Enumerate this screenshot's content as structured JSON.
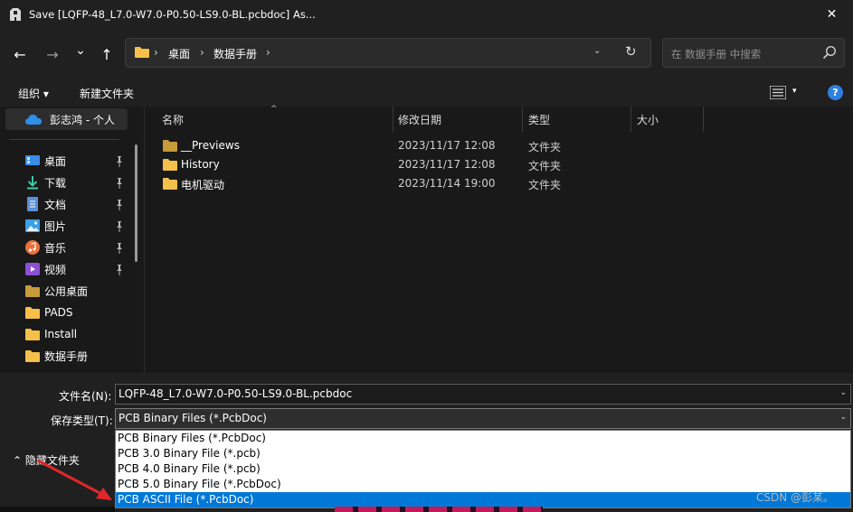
{
  "window": {
    "title": "Save [LQFP-48_L7.0-W7.0-P0.50-LS9.0-BL.pcbdoc] As...",
    "close_glyph": "✕"
  },
  "nav": {
    "back_glyph": "←",
    "forward_glyph": "→",
    "recent_glyph": "⌄",
    "up_glyph": "↑",
    "breadcrumbs": [
      "桌面",
      "数据手册"
    ],
    "crumb_sep": "›",
    "refresh_glyph": "↻",
    "dropdown_glyph": "⌄",
    "search_placeholder": "在 数据手册 中搜索"
  },
  "toolbar": {
    "organize_label": "组织 ▾",
    "new_folder_label": "新建文件夹",
    "view_caret": "▾",
    "help_glyph": "?"
  },
  "sidebar": {
    "cloud_label": "彭志鸿 - 个人",
    "items": [
      {
        "label": "桌面",
        "icon": "desktop-icon",
        "pinned": true
      },
      {
        "label": "下载",
        "icon": "download-icon",
        "pinned": true
      },
      {
        "label": "文档",
        "icon": "document-icon",
        "pinned": true
      },
      {
        "label": "图片",
        "icon": "picture-icon",
        "pinned": true
      },
      {
        "label": "音乐",
        "icon": "music-icon",
        "pinned": true
      },
      {
        "label": "视频",
        "icon": "video-icon",
        "pinned": true
      },
      {
        "label": "公用桌面",
        "icon": "folder-icon",
        "pinned": false
      },
      {
        "label": "PADS",
        "icon": "folder-icon",
        "pinned": false
      },
      {
        "label": "Install",
        "icon": "folder-icon",
        "pinned": false
      },
      {
        "label": "数据手册",
        "icon": "folder-icon",
        "pinned": false
      }
    ]
  },
  "filelist": {
    "columns": {
      "name": "名称",
      "date": "修改日期",
      "type": "类型",
      "size": "大小"
    },
    "sort_glyph": "^",
    "rows": [
      {
        "name": "__Previews",
        "date": "2023/11/17 12:08",
        "type": "文件夹"
      },
      {
        "name": "History",
        "date": "2023/11/17 12:08",
        "type": "文件夹"
      },
      {
        "name": "电机驱动",
        "date": "2023/11/14 19:00",
        "type": "文件夹"
      }
    ]
  },
  "save": {
    "filename_label": "文件名(N):",
    "filename_value": "LQFP-48_L7.0-W7.0-P0.50-LS9.0-BL.pcbdoc",
    "filetype_label": "保存类型(T):",
    "filetype_value": "PCB Binary Files (*.PcbDoc)",
    "dropdown_glyph": "⌄",
    "hide_folders_label": "⌃  隐藏文件夹",
    "filetype_options": [
      "PCB Binary Files (*.PcbDoc)",
      "PCB 3.0 Binary File (*.pcb)",
      "PCB 4.0 Binary File (*.pcb)",
      "PCB 5.0 Binary File (*.PcbDoc)",
      "PCB ASCII File (*.PcbDoc)"
    ],
    "selected_option_index": 4
  },
  "watermark": "CSDN @彭某。",
  "colors": {
    "folder": "#f5c04a",
    "accent": "#0078d7",
    "arrow": "#e0262b"
  }
}
